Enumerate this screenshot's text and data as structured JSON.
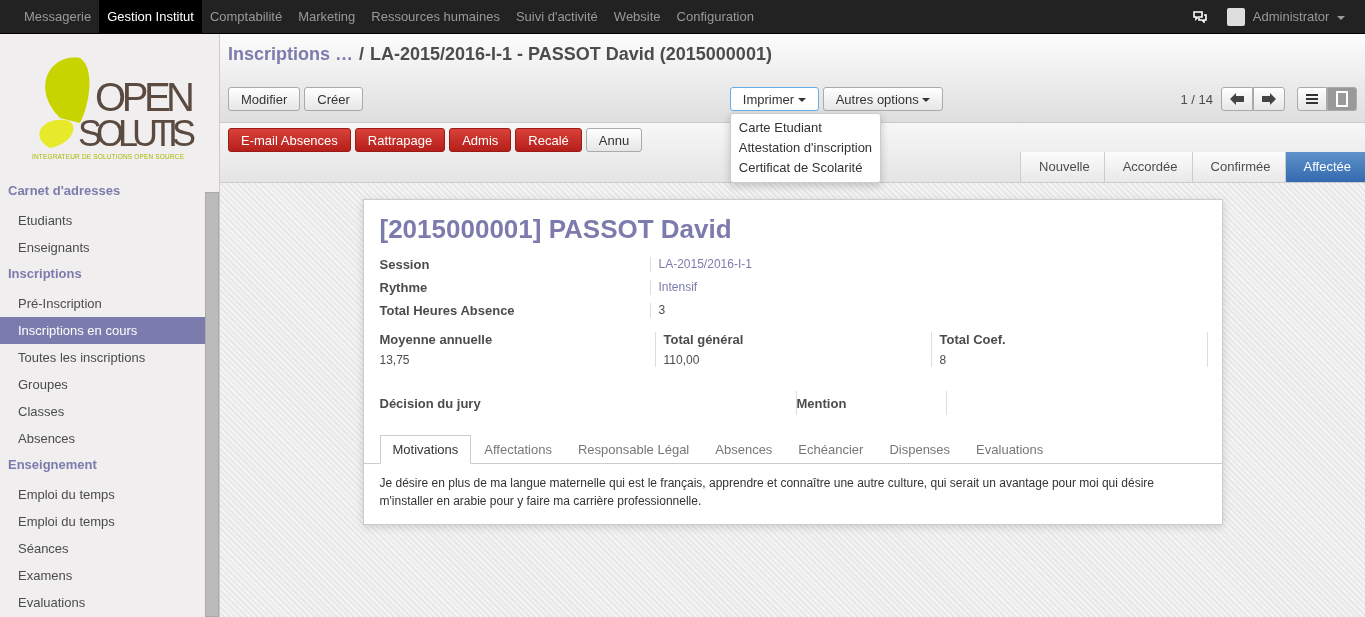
{
  "top_menu": [
    {
      "label": "Messagerie",
      "selected": false
    },
    {
      "label": "Gestion Institut",
      "selected": true
    },
    {
      "label": "Comptabilité",
      "selected": false
    },
    {
      "label": "Marketing",
      "selected": false
    },
    {
      "label": "Ressources humaines",
      "selected": false
    },
    {
      "label": "Suivi d'activité",
      "selected": false
    },
    {
      "label": "Website",
      "selected": false
    },
    {
      "label": "Configuration",
      "selected": false
    }
  ],
  "user": {
    "name": "Administrator"
  },
  "logo": {
    "line1": "OPEN",
    "line2": "SOLUTIS",
    "tagline": "INTEGRATEUR DE SOLUTIONS OPEN SOURCE"
  },
  "sidebar": [
    {
      "title": "Carnet d'adresses",
      "items": [
        {
          "label": "Etudiants",
          "selected": false
        },
        {
          "label": "Enseignants",
          "selected": false
        }
      ]
    },
    {
      "title": "Inscriptions",
      "items": [
        {
          "label": "Pré-Inscription",
          "selected": false
        },
        {
          "label": "Inscriptions en cours",
          "selected": true
        },
        {
          "label": "Toutes les inscriptions",
          "selected": false
        },
        {
          "label": "Groupes",
          "selected": false
        },
        {
          "label": "Classes",
          "selected": false
        },
        {
          "label": "Absences",
          "selected": false
        }
      ]
    },
    {
      "title": "Enseignement",
      "items": [
        {
          "label": "Emploi du temps",
          "selected": false
        },
        {
          "label": "Emploi du temps",
          "selected": false
        },
        {
          "label": "Séances",
          "selected": false
        },
        {
          "label": "Examens",
          "selected": false
        },
        {
          "label": "Evaluations",
          "selected": false
        }
      ]
    }
  ],
  "breadcrumb": {
    "parent": "Inscriptions …",
    "separator": "/",
    "current": "LA-2015/2016-I-1 - PASSOT David (2015000001)"
  },
  "buttons": [
    "Modifier",
    "Créer"
  ],
  "print": {
    "label": "Imprimer",
    "open": true,
    "items": [
      "Carte Etudiant",
      "Attestation d'inscription",
      "Certificat de Scolarité"
    ]
  },
  "more": {
    "label": "Autres options"
  },
  "pager": "1 / 14",
  "views": [
    {
      "kind": "list",
      "selected": false
    },
    {
      "kind": "form",
      "selected": true
    }
  ],
  "actions": [
    {
      "label": "E-mail Absences",
      "kind": "danger"
    },
    {
      "label": "Rattrapage",
      "kind": "danger"
    },
    {
      "label": "Admis",
      "kind": "danger"
    },
    {
      "label": "Recalé",
      "kind": "danger"
    },
    {
      "label": "Annu",
      "kind": "default"
    }
  ],
  "stages": [
    {
      "label": "Nouvelle",
      "selected": false
    },
    {
      "label": "Accordée",
      "selected": false
    },
    {
      "label": "Confirmée",
      "selected": false
    },
    {
      "label": "Affectée",
      "selected": true
    }
  ],
  "form": {
    "title": "[2015000001] PASSOT David",
    "fields": [
      {
        "label": "Session",
        "value": "LA-2015/2016-I-1",
        "link": true
      },
      {
        "label": "Rythme",
        "value": "Intensif",
        "link": true
      },
      {
        "label": "Total Heures Absence",
        "value": "3",
        "link": false
      }
    ],
    "totals": [
      {
        "label": "Moyenne annuelle",
        "value": "13,75"
      },
      {
        "label": "Total général",
        "value": "110,00"
      },
      {
        "label": "Total Coef.",
        "value": "8"
      }
    ],
    "jury": [
      {
        "label": "Décision du jury"
      },
      {
        "label": "Mention"
      }
    ],
    "tabs": [
      {
        "label": "Motivations",
        "selected": true
      },
      {
        "label": "Affectations",
        "selected": false
      },
      {
        "label": "Responsable Légal",
        "selected": false
      },
      {
        "label": "Absences",
        "selected": false
      },
      {
        "label": "Echéancier",
        "selected": false
      },
      {
        "label": "Dispenses",
        "selected": false
      },
      {
        "label": "Evaluations",
        "selected": false
      }
    ],
    "text": "Je désire en plus de ma langue maternelle qui est le français, apprendre et connaître une autre culture, qui serait un avantage pour moi qui désire m'installer en arabie pour y faire ma carrière professionnelle."
  }
}
